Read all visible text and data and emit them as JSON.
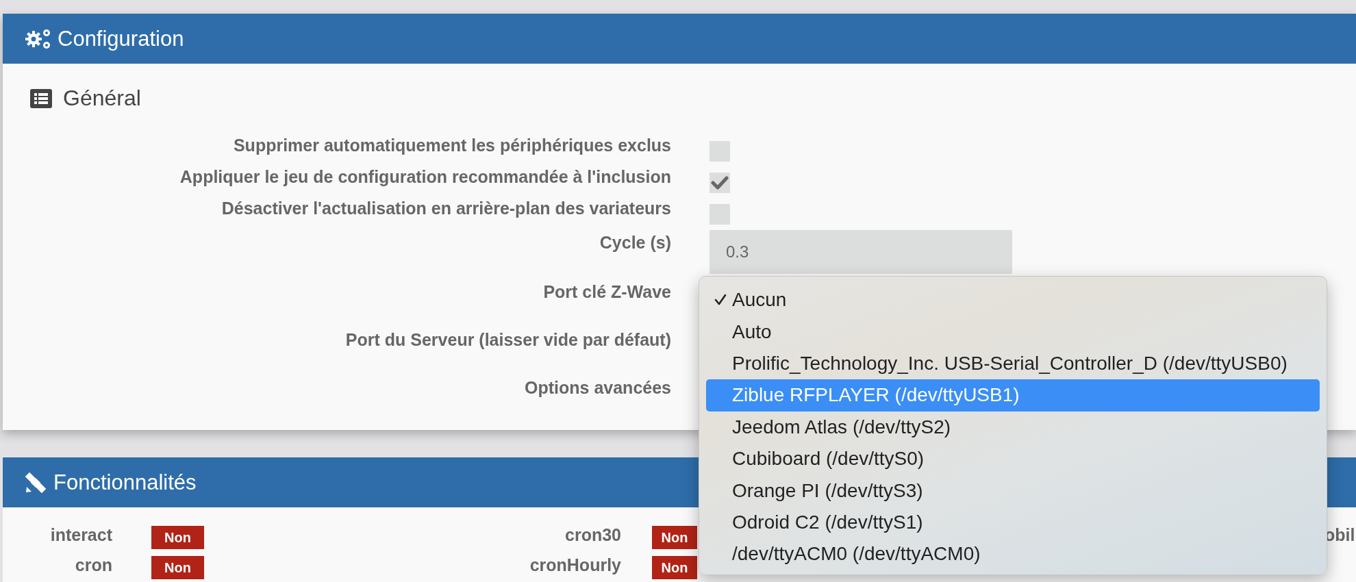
{
  "configuration": {
    "title": "Configuration",
    "section_title": "Général",
    "rows": [
      {
        "kind": "checkbox",
        "label": "Supprimer automatiquement les périphériques exclus",
        "checked": false
      },
      {
        "kind": "checkbox",
        "label": "Appliquer le jeu de configuration recommandée à l'inclusion",
        "checked": true
      },
      {
        "kind": "checkbox",
        "label": "Désactiver l'actualisation en arrière-plan des variateurs",
        "checked": false
      },
      {
        "kind": "input",
        "label": "Cycle (s)",
        "value": "0.3"
      },
      {
        "kind": "select",
        "label": "Port clé Z-Wave"
      },
      {
        "kind": "select",
        "label": "Port du Serveur (laisser vide par défaut)"
      },
      {
        "kind": "select",
        "label": "Options avancées"
      }
    ]
  },
  "features": {
    "title": "Fonctionnalités",
    "columns": [
      [
        {
          "label": "interact",
          "value": "Non",
          "enabled": false
        },
        {
          "label": "cron",
          "value": "Non",
          "enabled": false
        }
      ],
      [
        {
          "label": "cron30",
          "value": "Non",
          "enabled": false
        },
        {
          "label": "cronHourly",
          "value": "Non",
          "enabled": false
        }
      ],
      [
        {
          "label": "obil"
        }
      ]
    ]
  },
  "dropdown": {
    "options": [
      {
        "label": "Aucun",
        "checked": true,
        "selected": false
      },
      {
        "label": "Auto",
        "checked": false,
        "selected": false
      },
      {
        "label": "Prolific_Technology_Inc. USB-Serial_Controller_D (/dev/ttyUSB0)",
        "checked": false,
        "selected": false
      },
      {
        "label": "Ziblue RFPLAYER (/dev/ttyUSB1)",
        "checked": false,
        "selected": true
      },
      {
        "label": "Jeedom Atlas (/dev/ttyS2)",
        "checked": false,
        "selected": false
      },
      {
        "label": "Cubiboard (/dev/ttyS0)",
        "checked": false,
        "selected": false
      },
      {
        "label": "Orange PI (/dev/ttyS3)",
        "checked": false,
        "selected": false
      },
      {
        "label": "Odroid C2 (/dev/ttyS1)",
        "checked": false,
        "selected": false
      },
      {
        "label": "/dev/ttyACM0 (/dev/ttyACM0)",
        "checked": false,
        "selected": false
      }
    ]
  }
}
